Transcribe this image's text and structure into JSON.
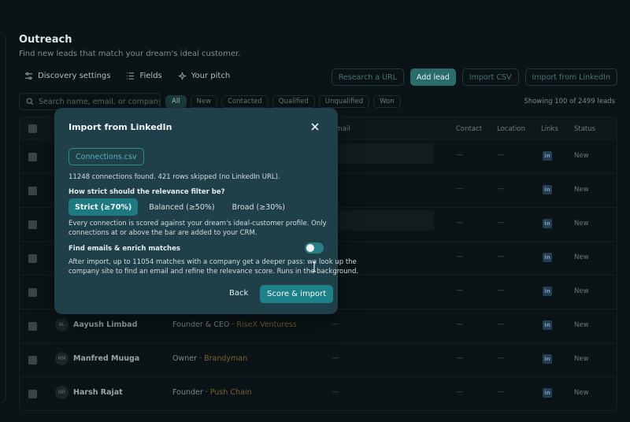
{
  "page": {
    "title": "Outreach",
    "subtitle": "Find new leads that match your dream's ideal customer."
  },
  "toolbar": {
    "discovery_settings": "Discovery settings",
    "fields": "Fields",
    "your_pitch": "Your pitch",
    "research_url": "Research a URL",
    "add_lead": "Add lead",
    "import_csv": "Import CSV",
    "import_linkedin": "Import from LinkedIn"
  },
  "search": {
    "placeholder": "Search name, email, or company"
  },
  "filters": [
    "All",
    "New",
    "Contacted",
    "Qualified",
    "Unqualified",
    "Won"
  ],
  "showing": "Showing 100 of 2499 leads",
  "table": {
    "headers": {
      "email": "Email",
      "contact": "Contact",
      "location": "Location",
      "links": "Links",
      "status": "Status"
    },
    "empty": "—",
    "linkedin_glyph": "in",
    "rows": [
      {
        "initials": "",
        "name": "",
        "role": "",
        "company": "",
        "status": "New"
      },
      {
        "initials": "",
        "name": "",
        "role": "",
        "company": "",
        "status": "New"
      },
      {
        "initials": "",
        "name": "",
        "role": "",
        "company": "",
        "status": "New"
      },
      {
        "initials": "",
        "name": "",
        "role": "",
        "company": "",
        "status": "New"
      },
      {
        "initials": "",
        "name": "",
        "role": "",
        "company": "",
        "status": "New"
      },
      {
        "initials": "AL",
        "name": "Aayush Limbad",
        "role": "Founder & CEO · ",
        "company": "RiseX Venturess",
        "status": "New"
      },
      {
        "initials": "MM",
        "name": "Manfred Muuga",
        "role": "Owner · ",
        "company": "Brandyman",
        "status": "New"
      },
      {
        "initials": "HR",
        "name": "Harsh Rajat",
        "role": "Founder · ",
        "company": "Push Chain",
        "status": "New"
      }
    ]
  },
  "modal": {
    "title": "Import from LinkedIn",
    "file_name": "Connections.csv",
    "summary": "11248 connections found. 421 rows skipped (no LinkedIn URL).",
    "strictness_question": "How strict should the relevance filter be?",
    "options": [
      "Strict (≥70%)",
      "Balanced (≥50%)",
      "Broad (≥30%)"
    ],
    "selected_option": 0,
    "scoring_line1": "Every connection is scored against your dream's ideal-customer profile. Only",
    "scoring_line2": "connections at or above the bar are added to your CRM.",
    "enrich_label": "Find emails & enrich matches",
    "enrich_enabled": true,
    "enrich_line1": "After import, up to 11054 matches with a company get a deeper pass: we look up the",
    "enrich_line2": "company site to find an email and refine the relevance score. Runs in the background.",
    "back_label": "Back",
    "primary_label": "Score & import"
  }
}
